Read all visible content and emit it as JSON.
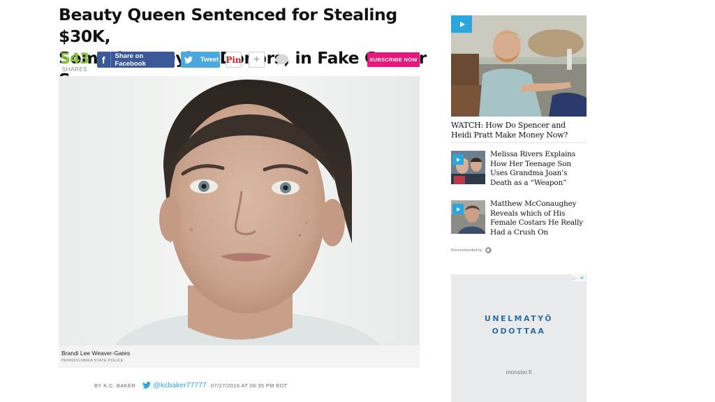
{
  "article": {
    "headline_line1": "Beauty Queen Sentenced for Stealing $30K,",
    "headline_line2": "Some from Dying Donors, in Fake Cancer Scam",
    "share_count": "543",
    "share_label": "SHARES",
    "facebook_label": "Share on Facebook",
    "tweet_label": "Tweet",
    "pinterest_label": "Pin",
    "more_label": "+",
    "subscribe_label": "SUBSCRIBE NOW",
    "caption_name": "Brandi Lee Weaver-Gates",
    "caption_credit": "PENNSYLVANIA STATE POLICE",
    "byline": "BY K.C. BAKER",
    "twitter_handle": "@kcbaker77777",
    "datetime": "07/27/2016 AT 06:35 PM EDT"
  },
  "sidebar": {
    "featured_title": "WATCH: How Do Spencer and Heidi Pratt Make Money Now?",
    "items": [
      {
        "title": "Melissa Rivers Explains How Her Teenage Son Uses Grandma Joan’s Death as a “Weapon”"
      },
      {
        "title": "Matthew McConaughey Reveals which of His Female Costars He Really Had a Crush On"
      }
    ],
    "recommended_label": "Recommended by"
  },
  "ad": {
    "line1": "UNELMATYÖ",
    "line2": "ODOTTAA",
    "domain": "monster.fi"
  },
  "colors": {
    "share_count": "#8cc63f",
    "facebook": "#3b5998",
    "twitter": "#4aa8dc",
    "pinterest": "#cb2027",
    "subscribe": "#e5197b",
    "play_button": "#2aa6de",
    "ad_text": "#2e6ea6"
  }
}
